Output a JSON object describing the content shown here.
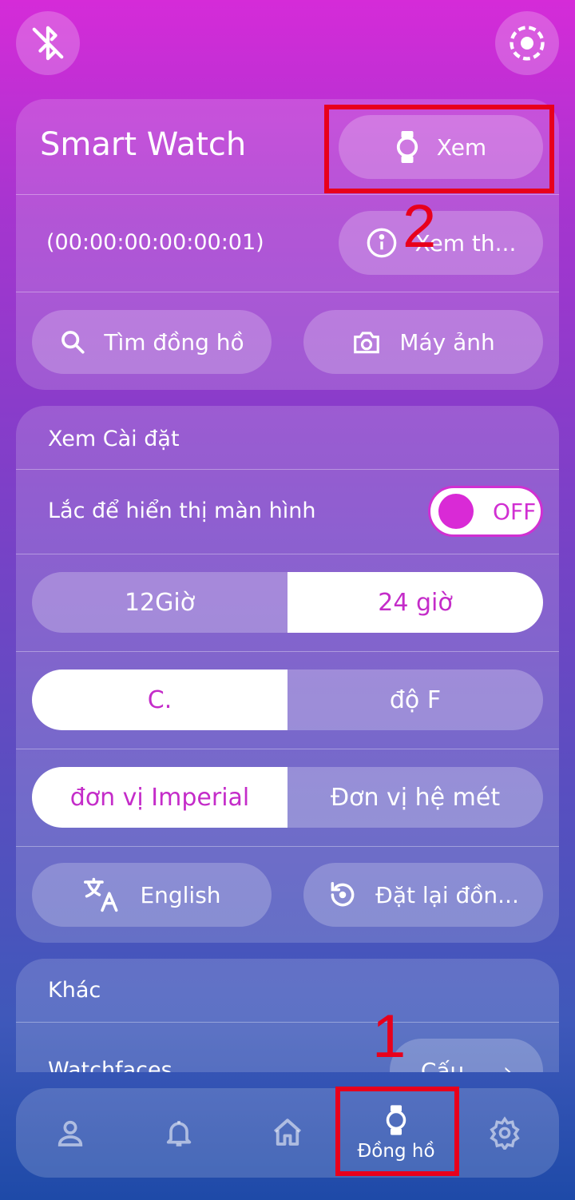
{
  "top": {
    "left_icon": "bluetooth-off-icon",
    "right_icon": "scan-icon"
  },
  "device": {
    "name": "Smart Watch",
    "view_label": "Xem",
    "address": "(00:00:00:00:00:01)",
    "info_label": "Xem th...",
    "find_label": "Tìm đồng hồ",
    "camera_label": "Máy ảnh"
  },
  "settings": {
    "title": "Xem Cài đặt",
    "shake_label": "Lắc để hiển thị màn hình",
    "shake_toggle": "OFF",
    "time_12": "12Giờ",
    "time_24": "24 giờ",
    "temp_c": "C.",
    "temp_f": "độ F",
    "unit_imperial": "đơn vị Imperial",
    "unit_metric": "Đơn vị hệ mét",
    "language_label": "English",
    "reset_label": "Đặt lại đồn..."
  },
  "other": {
    "title": "Khác",
    "watchfaces_label": "Watchfaces",
    "watchfaces_button": "Cấu..."
  },
  "nav": {
    "active_label": "Đồng hồ",
    "items": [
      "profile-icon",
      "bell-icon",
      "home-icon",
      "watch-icon",
      "gear-icon"
    ]
  },
  "annotations": {
    "one": "1",
    "two": "2"
  },
  "colors": {
    "accent": "#d12fd2",
    "annotation": "#e8001c"
  }
}
